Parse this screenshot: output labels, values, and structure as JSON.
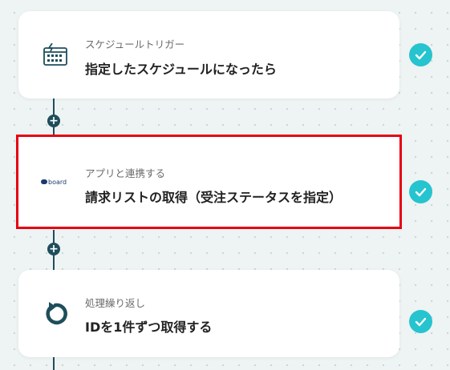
{
  "flow": {
    "steps": [
      {
        "label": "スケジュールトリガー",
        "title": "指定したスケジュールになったら",
        "icon": "calendar-icon",
        "status": "completed"
      },
      {
        "label": "アプリと連携する",
        "title": "請求リストの取得（受注ステータスを指定）",
        "icon": "board-logo",
        "logo_text": "board",
        "status": "completed",
        "selected": true
      },
      {
        "label": "処理繰り返し",
        "title": "IDを1件ずつ取得する",
        "icon": "loop-icon",
        "status": "completed"
      }
    ],
    "add_button_glyph": "+",
    "colors": {
      "accent": "#25c4cf",
      "connector": "#1e4e5c",
      "selection": "#e60012",
      "background": "#eef3f3"
    }
  }
}
